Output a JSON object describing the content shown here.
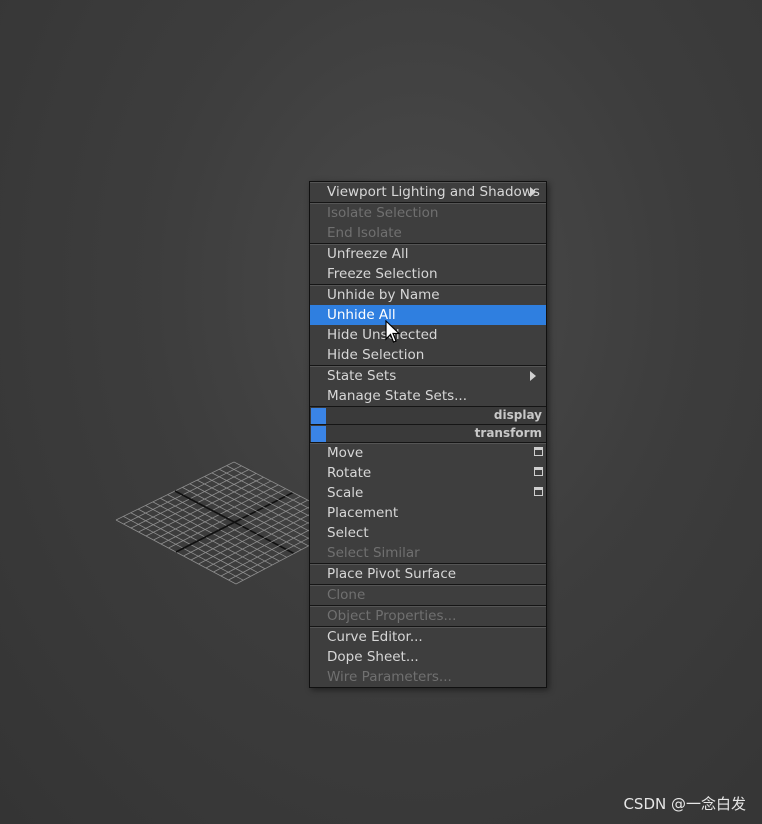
{
  "quad_menu": {
    "groups": [
      {
        "items": [
          {
            "label": "Viewport Lighting and Shadows",
            "disabled": false,
            "submenu": true
          }
        ]
      },
      {
        "items": [
          {
            "label": "Isolate Selection",
            "disabled": true
          },
          {
            "label": "End Isolate",
            "disabled": true
          }
        ]
      },
      {
        "items": [
          {
            "label": "Unfreeze All",
            "disabled": false
          },
          {
            "label": "Freeze Selection",
            "disabled": false
          }
        ]
      },
      {
        "items": [
          {
            "label": "Unhide by Name",
            "disabled": false
          },
          {
            "label": "Unhide All",
            "disabled": false,
            "highlighted": true
          },
          {
            "label": "Hide Unselected",
            "disabled": false
          },
          {
            "label": "Hide Selection",
            "disabled": false
          }
        ]
      },
      {
        "items": [
          {
            "label": "State Sets",
            "disabled": false,
            "submenu": true
          },
          {
            "label": "Manage State Sets...",
            "disabled": false
          }
        ]
      }
    ],
    "headers": {
      "display": "display",
      "transform": "transform"
    },
    "transform_group": [
      {
        "label": "Move",
        "disabled": false,
        "options": true
      },
      {
        "label": "Rotate",
        "disabled": false,
        "options": true
      },
      {
        "label": "Scale",
        "disabled": false,
        "options": true
      },
      {
        "label": "Placement",
        "disabled": false
      },
      {
        "label": "Select",
        "disabled": false
      },
      {
        "label": "Select Similar",
        "disabled": true
      }
    ],
    "pivot_group": [
      {
        "label": "Place Pivot Surface",
        "disabled": false
      }
    ],
    "clone_group": [
      {
        "label": "Clone",
        "disabled": true
      }
    ],
    "props_group": [
      {
        "label": "Object Properties...",
        "disabled": true
      }
    ],
    "curve_group": [
      {
        "label": "Curve Editor...",
        "disabled": false
      },
      {
        "label": "Dope Sheet...",
        "disabled": false
      },
      {
        "label": "Wire Parameters...",
        "disabled": true
      }
    ],
    "highlight_color": "#2f7fe0",
    "swatch_color": "#3a84e6"
  },
  "viewport": {
    "object": "grid-plane",
    "icons": {
      "cursor": "arrow-cursor-icon",
      "submenu": "chevron-right-icon",
      "options": "options-box-icon"
    }
  },
  "watermark": "CSDN @一念白发"
}
